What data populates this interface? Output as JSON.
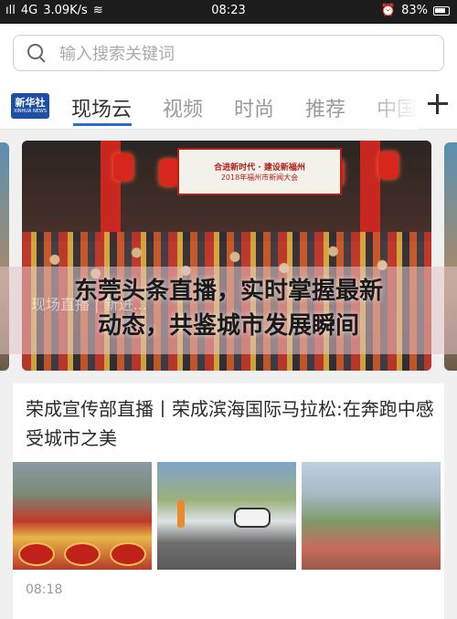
{
  "status_bar": {
    "signal": "ıll",
    "network": "4G",
    "speed": "3.09K/s",
    "time": "08:23",
    "battery": "83%"
  },
  "search": {
    "placeholder": "输入搜索关键词"
  },
  "tabs": {
    "logo": {
      "main": "新华社",
      "sub": "XINHUA NEWS"
    },
    "items": [
      {
        "label": "现场云",
        "active": true
      },
      {
        "label": "视频",
        "active": false
      },
      {
        "label": "时尚",
        "active": false
      },
      {
        "label": "推荐",
        "active": false
      },
      {
        "label": "中国",
        "active": false
      }
    ]
  },
  "carousel": {
    "banner_line1": "合进新时代 · 建设新福州",
    "banner_line2": "2018年福州市新闻大会",
    "caption_partial": "现场直播 | 新进...",
    "headline": "东莞头条直播，实时掌握最新动态，共鉴城市发展瞬间",
    "headline_line1": "东莞头条直播，实时掌握最新",
    "headline_line2": "动态，共鉴城市发展瞬间",
    "slides": 5,
    "active_slide": 2
  },
  "news": {
    "title": "荣成宣传部直播丨荣成滨海国际马拉松:在奔跑中感受城市之美",
    "time": "08:18",
    "thumbnails": [
      "drum-performance-photo",
      "marathon-runner-photo",
      "coastal-city-photo"
    ]
  },
  "colors": {
    "accent": "#2a6bd6",
    "logo_bg": "#1f4fa3",
    "red": "#c8271f"
  }
}
